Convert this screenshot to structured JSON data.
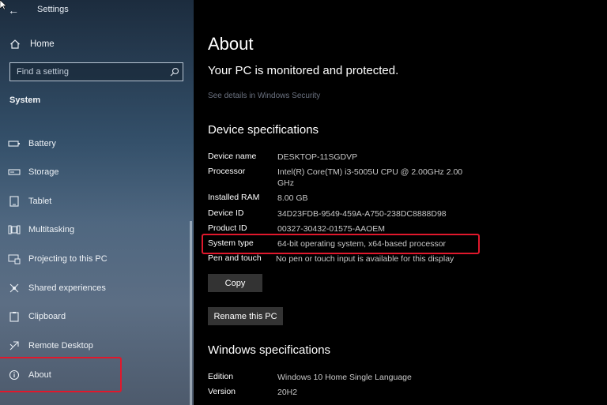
{
  "window": {
    "title": "Settings"
  },
  "sidebar": {
    "home_label": "Home",
    "search_placeholder": "Find a setting",
    "section_title": "System",
    "items": [
      {
        "label": "Battery",
        "icon": "battery-icon"
      },
      {
        "label": "Storage",
        "icon": "storage-icon"
      },
      {
        "label": "Tablet",
        "icon": "tablet-icon"
      },
      {
        "label": "Multitasking",
        "icon": "multitasking-icon"
      },
      {
        "label": "Projecting to this PC",
        "icon": "projecting-icon"
      },
      {
        "label": "Shared experiences",
        "icon": "shared-experiences-icon"
      },
      {
        "label": "Clipboard",
        "icon": "clipboard-icon"
      },
      {
        "label": "Remote Desktop",
        "icon": "remote-desktop-icon"
      },
      {
        "label": "About",
        "icon": "info-icon"
      }
    ]
  },
  "main": {
    "title": "About",
    "protection_status": "Your PC is monitored and protected.",
    "security_link": "See details in Windows Security",
    "device_heading": "Device specifications",
    "device_specs": [
      {
        "label": "Device name",
        "value": "DESKTOP-11SGDVP"
      },
      {
        "label": "Processor",
        "value": "Intel(R) Core(TM) i3-5005U CPU @ 2.00GHz   2.00 GHz"
      },
      {
        "label": "Installed RAM",
        "value": "8.00 GB"
      },
      {
        "label": "Device ID",
        "value": "34D23FDB-9549-459A-A750-238DC8888D98"
      },
      {
        "label": "Product ID",
        "value": "00327-30432-01575-AAOEM"
      },
      {
        "label": "System type",
        "value": "64-bit operating system, x64-based processor"
      },
      {
        "label": "Pen and touch",
        "value": "No pen or touch input is available for this display"
      }
    ],
    "copy_label": "Copy",
    "rename_label": "Rename this PC",
    "windows_heading": "Windows specifications",
    "windows_specs": [
      {
        "label": "Edition",
        "value": "Windows 10 Home Single Language"
      },
      {
        "label": "Version",
        "value": "20H2"
      }
    ]
  },
  "colors": {
    "highlight": "#e0182c",
    "button_bg": "#333333",
    "content_bg": "#000000"
  }
}
